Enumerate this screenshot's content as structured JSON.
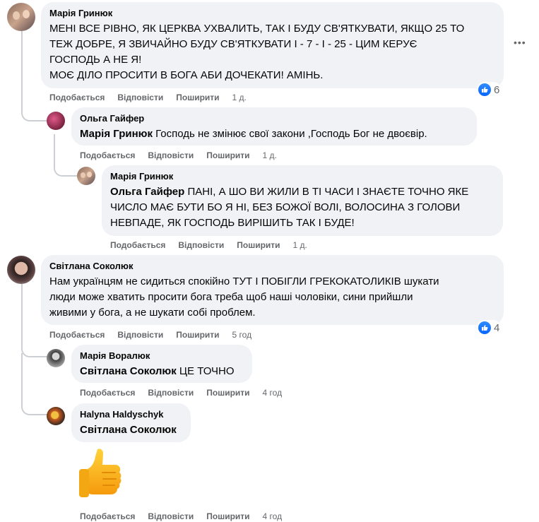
{
  "actions": {
    "like": "Подобається",
    "reply": "Відповісти",
    "share": "Поширити"
  },
  "comments": [
    {
      "author": "Марія Гринюк",
      "mention": "",
      "text_lines": [
        "МЕНІ ВСЕ РІВНО, ЯК ЦЕРКВА УХВАЛИТЬ, ТАК І БУДУ СВ'ЯТКУВАТИ, ЯКЩО 25 ТО",
        "ТЕЖ ДОБРЕ, Я ЗВИЧАЙНО БУДУ СВ'ЯТКУВАТИ І - 7 - І - 25 - ЦИМ КЕРУЄ",
        "ГОСПОДЬ А НЕ Я!",
        "МОЄ ДІЛО ПРОСИТИ В БОГА АБИ ДОЧЕКАТИ! АМІНЬ."
      ],
      "time": "1 д.",
      "reactions": "6",
      "more": "•••"
    },
    {
      "author": "Ольга Гайфер",
      "mention": "Марія Гринюк",
      "text": " Господь не змінює свої закони ,Господь Бог не двоєвір.",
      "time": "1 д."
    },
    {
      "author": "Марія Гринюк",
      "mention": "Ольга Гайфер",
      "text_first": " ПАНІ, А ШО ВИ ЖИЛИ В ТІ ЧАСИ І ЗНАЄТЕ ТОЧНО ЯКЕ",
      "text_lines": [
        "ЧИСЛО МАЄ БУТИ БО Я НІ, БЕЗ БОЖОЇ ВОЛІ, ВОЛОСИНА З ГОЛОВИ",
        "НЕВПАДЕ, ЯК ГОСПОДЬ ВИРІШИТЬ ТАК І БУДЕ!"
      ],
      "time": "1 д."
    },
    {
      "author": "Світлана Соколюк",
      "mention": "",
      "text_lines": [
        "Нам українцям не сидиться спокійно ТУТ І ПОБІГЛИ ГРЕКОКАТОЛИКІВ шукати",
        "люди може хватить просити бога треба щоб наші чоловіки, сини прийшли",
        "живими у бога, а не шукати собі проблем."
      ],
      "time": "5 год",
      "reactions": "4"
    },
    {
      "author": "Марія Воралюк",
      "mention": "Світлана Соколюк",
      "text": " ЦЕ ТОЧНО",
      "time": "4 год"
    },
    {
      "author": "Halyna Haldyschyk",
      "mention": "Світлана Соколюк",
      "text": "",
      "time": "4 год",
      "sticker": "thumbs-up"
    }
  ]
}
